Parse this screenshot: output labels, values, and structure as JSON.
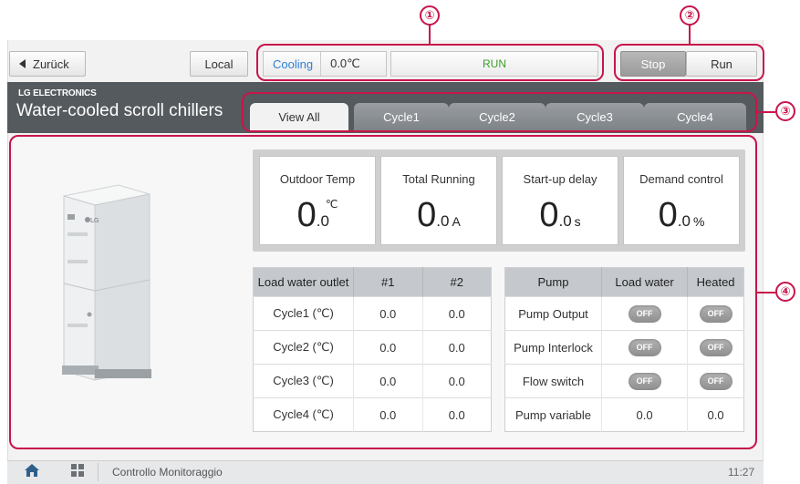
{
  "topbar": {
    "back_label": "Zurück",
    "local_label": "Local",
    "mode_label": "Cooling",
    "mode_temp": "0.0℃",
    "run_status": "RUN",
    "stop_label": "Stop",
    "run_label": "Run"
  },
  "callouts": [
    "①",
    "②",
    "③",
    "④"
  ],
  "header": {
    "brand": "LG ELECTRONICS",
    "title": "Water-cooled scroll chillers"
  },
  "tabs": [
    {
      "label": "View All",
      "active": true
    },
    {
      "label": "Cycle1"
    },
    {
      "label": "Cycle2"
    },
    {
      "label": "Cycle3"
    },
    {
      "label": "Cycle4"
    }
  ],
  "cards": [
    {
      "label": "Outdoor Temp",
      "int": "0",
      "dec": ".0",
      "unit": "℃"
    },
    {
      "label": "Total Running",
      "int": "0",
      "dec": ".0",
      "unit": "A"
    },
    {
      "label": "Start-up delay",
      "int": "0",
      "dec": ".0",
      "unit": "s"
    },
    {
      "label": "Demand control",
      "int": "0",
      "dec": ".0",
      "unit": "%"
    }
  ],
  "outlet_table": {
    "headers": [
      "Load water outlet",
      "#1",
      "#2"
    ],
    "rows": [
      [
        "Cycle1 (℃)",
        "0.0",
        "0.0"
      ],
      [
        "Cycle2 (℃)",
        "0.0",
        "0.0"
      ],
      [
        "Cycle3 (℃)",
        "0.0",
        "0.0"
      ],
      [
        "Cycle4 (℃)",
        "0.0",
        "0.0"
      ]
    ]
  },
  "pump_table": {
    "headers": [
      "Pump",
      "Load water",
      "Heated"
    ],
    "rows": [
      [
        "Pump Output",
        "OFF",
        "OFF"
      ],
      [
        "Pump Interlock",
        "OFF",
        "OFF"
      ],
      [
        "Flow switch",
        "OFF",
        "OFF"
      ],
      [
        "Pump variable",
        "0.0",
        "0.0"
      ]
    ]
  },
  "bottom": {
    "title": "Controllo Monitoraggio",
    "time": "11:27"
  },
  "colors": {
    "callout": "#c8154b",
    "mode": "#2f7fd3",
    "run": "#3d9d2a",
    "band": "#555a5e"
  },
  "icons": [
    "back-arrow-icon",
    "home-icon",
    "apps-grid-icon"
  ]
}
